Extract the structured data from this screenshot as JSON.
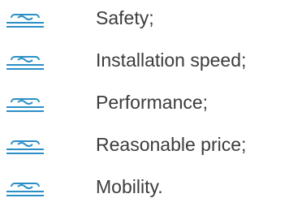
{
  "list": {
    "icon": "wave-underline-icon",
    "icon_color": "#2b8fc6",
    "text_color": "#3c3c3c",
    "items": [
      {
        "label": "Safety;"
      },
      {
        "label": "Installation speed;"
      },
      {
        "label": "Performance;"
      },
      {
        "label": "Reasonable price;"
      },
      {
        "label": "Mobility."
      }
    ]
  }
}
